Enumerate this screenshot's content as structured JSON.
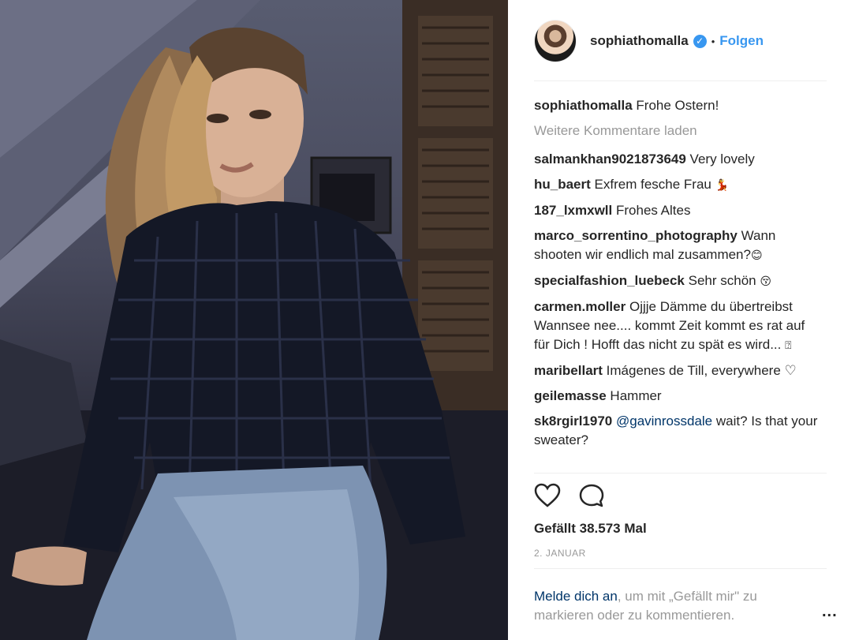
{
  "post": {
    "username": "sophiathomalla",
    "verified_icon": "verified-badge-icon",
    "separator_dot": "•",
    "follow_label": "Folgen",
    "caption_user": "sophiathomalla",
    "caption_text": "Frohe Ostern!",
    "load_more": "Weitere Kommentare laden",
    "likes": "Gefällt 38.573 Mal",
    "date": "2. JANUAR"
  },
  "comments": [
    {
      "user": "salmankhan9021873649",
      "text": "Very lovely"
    },
    {
      "user": "hu_baert",
      "text": "Exfrem fesche Frau",
      "emoji": "💃"
    },
    {
      "user": "187_lxmxwll",
      "text": "Frohes Altes"
    },
    {
      "user": "marco_sorrentino_photography",
      "text": "Wann shooten wir endlich mal zusammen?",
      "emoji": "😊"
    },
    {
      "user": "specialfashion_luebeck",
      "text": "Sehr schön",
      "emoji": "😚"
    },
    {
      "user": "carmen.moller",
      "text": "Ojjje Dämme du übertreibst Wannsee nee.... kommt Zeit kommt es rat auf für Dich ! Hofft das nicht zu spät es wird...",
      "emoji": "⍰"
    },
    {
      "user": "maribellart",
      "text": "Imágenes de Till, everywhere ♡"
    },
    {
      "user": "geilemasse",
      "text": "Hammer"
    },
    {
      "user": "sk8rgirl1970",
      "mention": "@gavinrossdale",
      "text": "wait? Is that your sweater?"
    }
  ],
  "footer": {
    "login_link": "Melde dich an",
    "login_rest": ", um mit „Gefällt mir\" zu markieren oder zu kommentieren.",
    "more_label": "..."
  },
  "colors": {
    "link_blue": "#3897f0",
    "text": "#262626",
    "muted": "#999999",
    "dark_link": "#003569"
  }
}
